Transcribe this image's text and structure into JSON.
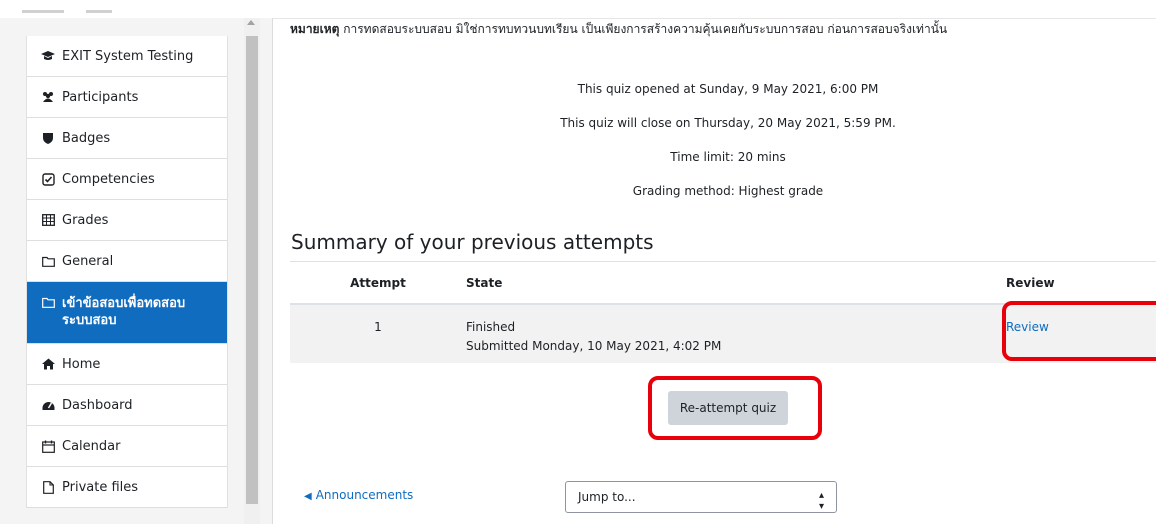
{
  "nav": {
    "items": [
      {
        "label": "EXIT System Testing",
        "icon": "graduation-cap-icon"
      },
      {
        "label": "Participants",
        "icon": "users-icon"
      },
      {
        "label": "Badges",
        "icon": "shield-icon"
      },
      {
        "label": "Competencies",
        "icon": "check-square-icon"
      },
      {
        "label": "Grades",
        "icon": "table-icon"
      },
      {
        "label": "General",
        "icon": "folder-icon"
      },
      {
        "label": "เข้าข้อสอบเพื่อทดสอบระบบสอบ",
        "icon": "folder-icon"
      },
      {
        "label": "Home",
        "icon": "home-icon"
      },
      {
        "label": "Dashboard",
        "icon": "dashboard-icon"
      },
      {
        "label": "Calendar",
        "icon": "calendar-icon"
      },
      {
        "label": "Private files",
        "icon": "file-icon"
      }
    ]
  },
  "main": {
    "note_label": "หมายเหตุ",
    "note_text": " การทดสอบระบบสอบ มิใช่การทบทวนบทเรียน เป็นเพียงการสร้างความคุ้นเคยกับระบบการสอบ ก่อนการสอบจริงเท่านั้น",
    "opened": "This quiz opened at Sunday, 9 May 2021, 6:00 PM",
    "closes": "This quiz will close on Thursday, 20 May 2021, 5:59 PM.",
    "time_limit": "Time limit: 20 mins",
    "grading": "Grading method: Highest grade",
    "summary_title": "Summary of your previous attempts",
    "table": {
      "headers": [
        "Attempt",
        "State",
        "Review"
      ],
      "rows": [
        {
          "attempt": "1",
          "state": "Finished",
          "submitted": "Submitted Monday, 10 May 2021, 4:02 PM",
          "review": "Review"
        }
      ]
    },
    "reattempt_label": "Re-attempt quiz",
    "prev_link": "Announcements",
    "jump_placeholder": "Jump to..."
  },
  "colors": {
    "accent": "#0f6cbf",
    "highlight": "#e8000b"
  }
}
